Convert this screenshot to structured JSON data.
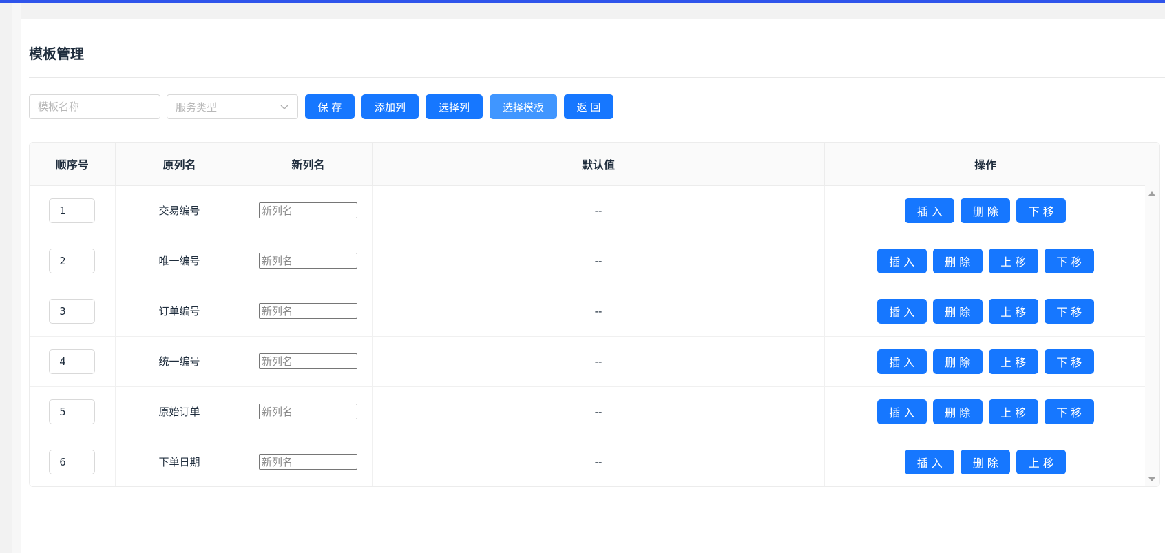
{
  "page": {
    "title": "模板管理"
  },
  "toolbar": {
    "template_name_placeholder": "模板名称",
    "service_type_placeholder": "服务类型",
    "save": "保 存",
    "add_column": "添加列",
    "select_column": "选择列",
    "select_template": "选择模板",
    "back": "返 回"
  },
  "table": {
    "headers": [
      "顺序号",
      "原列名",
      "新列名",
      "默认值",
      "操作"
    ],
    "newname_placeholder": "新列名",
    "rows": [
      {
        "seq": "1",
        "original": "交易编号",
        "default": "--",
        "ops": [
          "插 入",
          "删 除",
          "下 移"
        ]
      },
      {
        "seq": "2",
        "original": "唯一编号",
        "default": "--",
        "ops": [
          "插 入",
          "删 除",
          "上 移",
          "下 移"
        ]
      },
      {
        "seq": "3",
        "original": "订单编号",
        "default": "--",
        "ops": [
          "插 入",
          "删 除",
          "上 移",
          "下 移"
        ]
      },
      {
        "seq": "4",
        "original": "统一编号",
        "default": "--",
        "ops": [
          "插 入",
          "删 除",
          "上 移",
          "下 移"
        ]
      },
      {
        "seq": "5",
        "original": "原始订单",
        "default": "--",
        "ops": [
          "插 入",
          "删 除",
          "上 移",
          "下 移"
        ]
      },
      {
        "seq": "6",
        "original": "下单日期",
        "default": "--",
        "ops": [
          "插 入",
          "删 除",
          "上 移"
        ]
      }
    ]
  },
  "colors": {
    "primary": "#1677ff",
    "primary_light": "#4096ff",
    "topbar": "#2f54eb"
  },
  "icons": {
    "select_arrow": "chevron-down-icon",
    "scroll_up": "scroll-up-arrow-icon",
    "scroll_down": "scroll-down-arrow-icon"
  }
}
